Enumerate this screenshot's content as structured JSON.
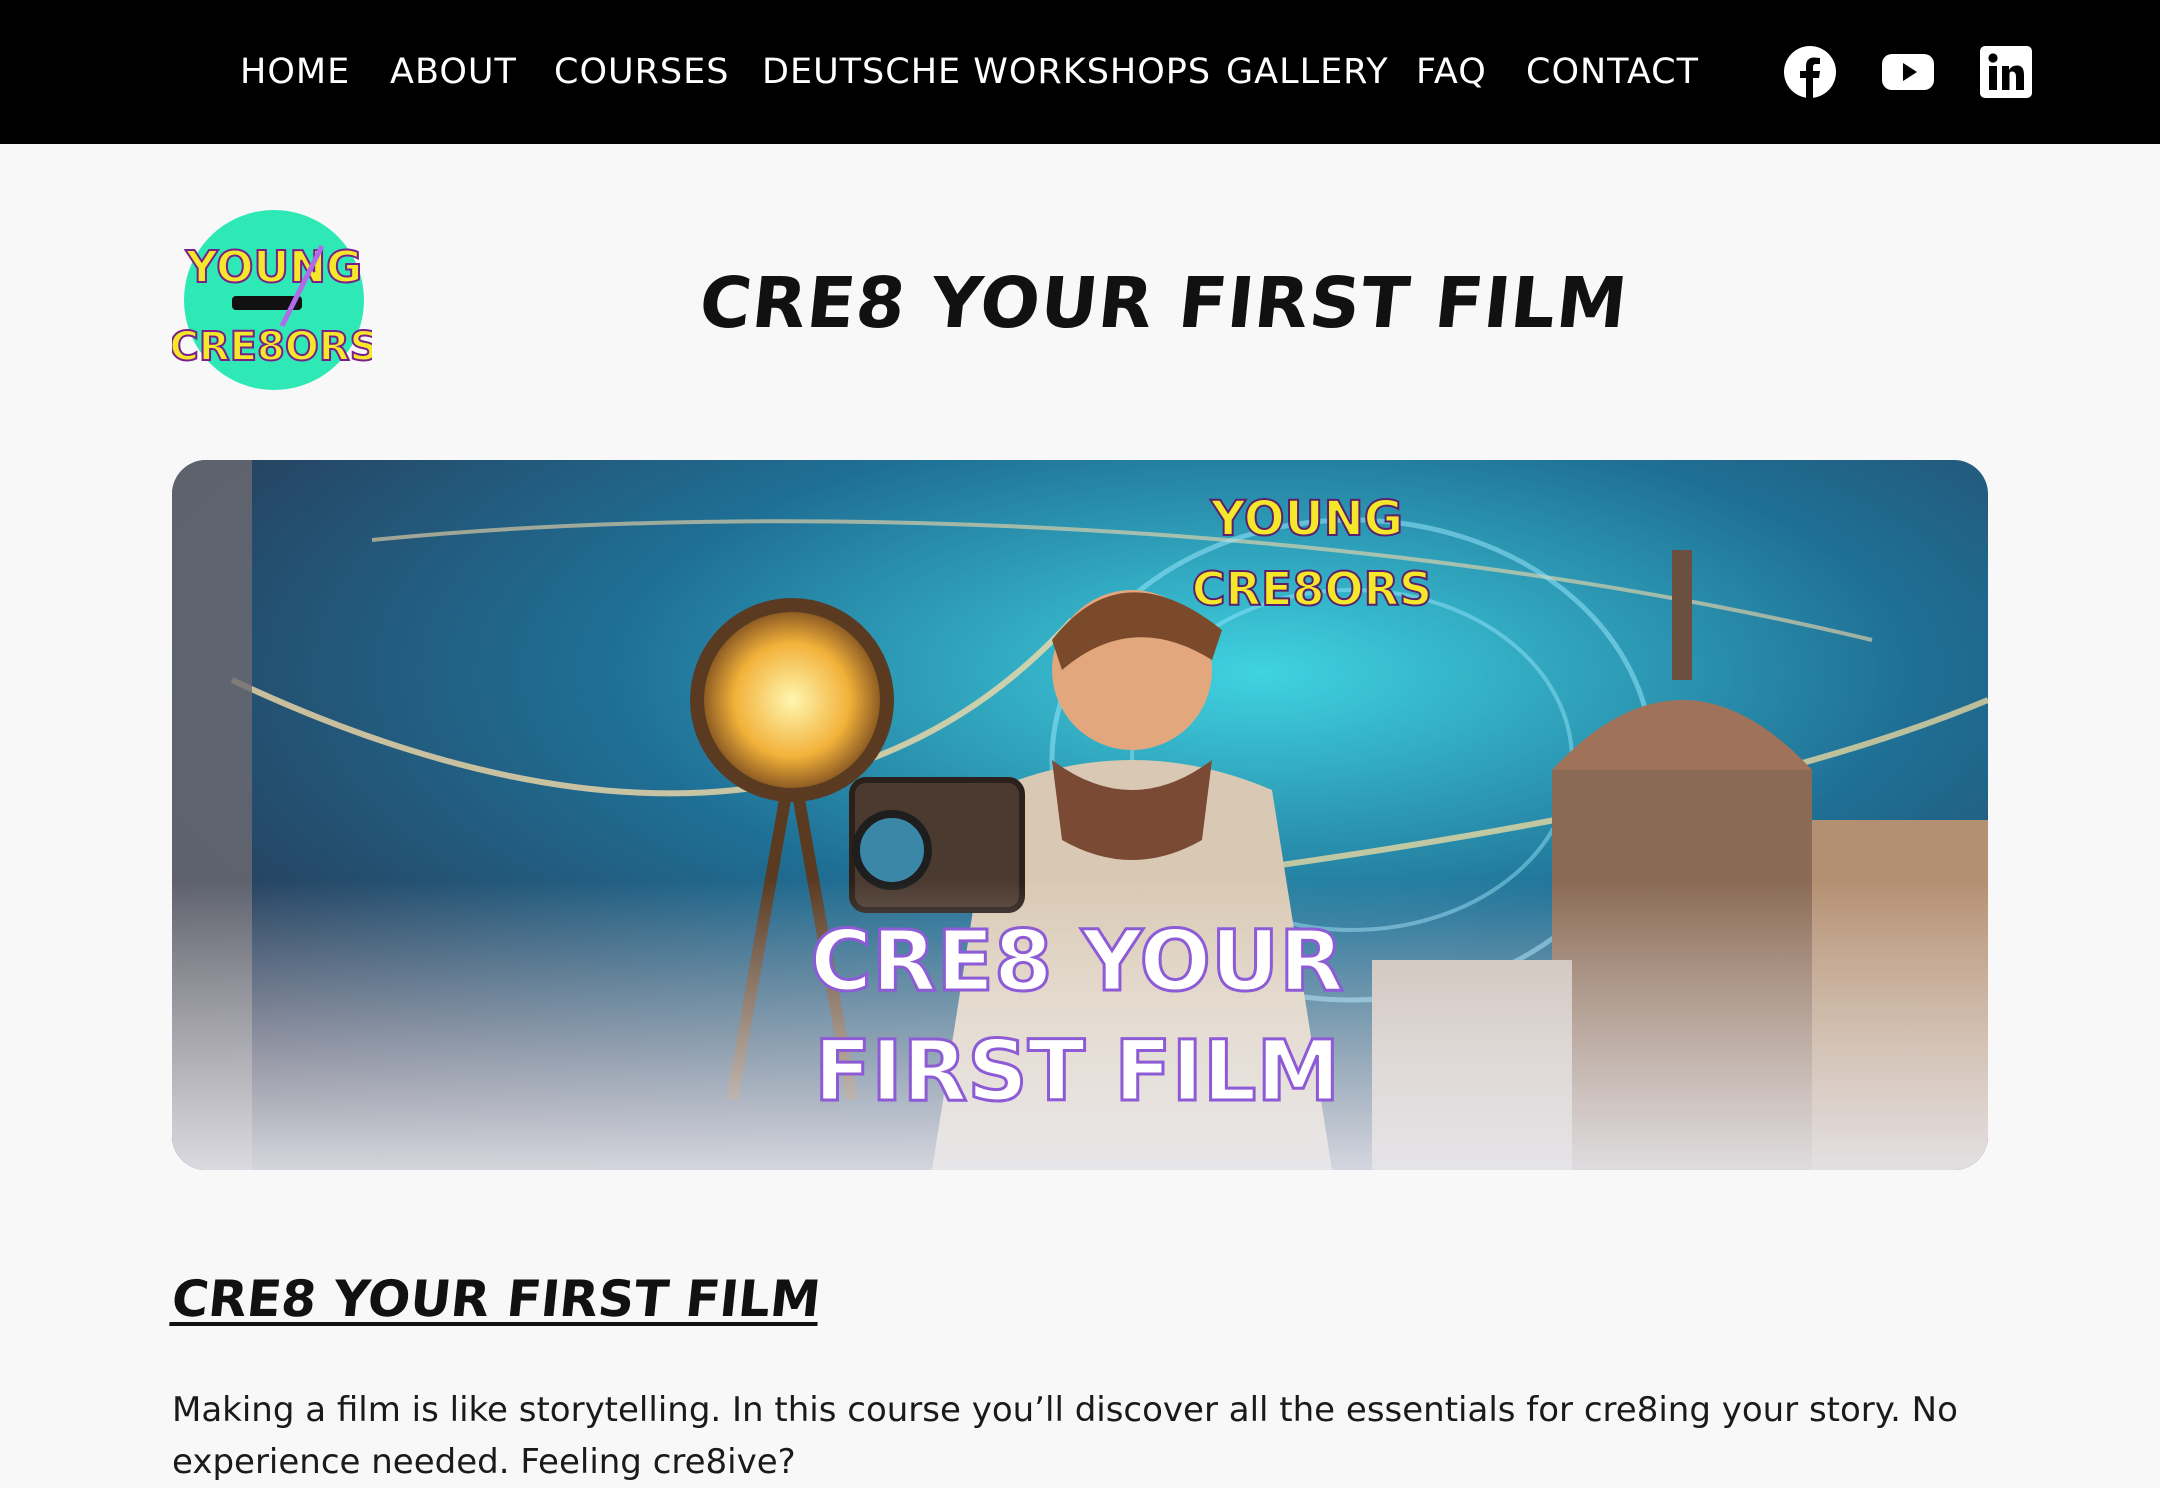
{
  "nav": {
    "items": [
      {
        "label": "HOME"
      },
      {
        "label": "ABOUT"
      },
      {
        "label": "COURSES"
      },
      {
        "label": "DEUTSCHE WORKSHOPS"
      },
      {
        "label": "GALLERY"
      },
      {
        "label": "FAQ"
      },
      {
        "label": "CONTACT"
      }
    ],
    "social_icons": [
      "facebook-icon",
      "youtube-icon",
      "linkedin-icon"
    ]
  },
  "logo": {
    "line1": "YOUNG",
    "line2": "CRE8ORS"
  },
  "page": {
    "title": "CRE8 YOUR FIRST FILM"
  },
  "hero": {
    "logo_line1": "YOUNG",
    "logo_line2": "CRE8ORS",
    "caption_line1": "CRE8 YOUR",
    "caption_line2": "FIRST FILM"
  },
  "content": {
    "heading": "CRE8 YOUR FIRST FILM",
    "paragraph": "Making a film is like storytelling. In this course you’ll discover all the essentials for cre8ing your story. No experience needed. Feeling cre8ive?"
  },
  "colors": {
    "nav_bg": "#000000",
    "page_bg": "#f8f8f8",
    "logo_circle": "#2ee8b6",
    "logo_text": "#f5e82a"
  }
}
